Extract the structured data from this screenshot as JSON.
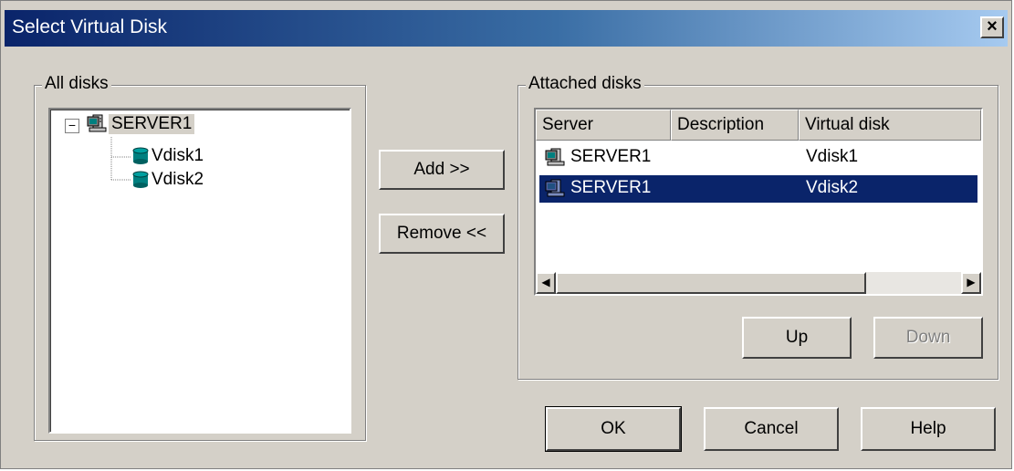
{
  "window": {
    "title": "Select Virtual Disk",
    "close_glyph": "×"
  },
  "all_disks": {
    "label": "All disks",
    "tree": {
      "expander": "−",
      "server": "SERVER1",
      "children": [
        "Vdisk1",
        "Vdisk2"
      ]
    }
  },
  "center_buttons": {
    "add": "Add >>",
    "remove": "Remove <<"
  },
  "attached_disks": {
    "label": "Attached disks",
    "columns": [
      "Server",
      "Description",
      "Virtual disk"
    ],
    "rows": [
      {
        "server": "SERVER1",
        "description": "",
        "virtual_disk": "Vdisk1",
        "selected": false
      },
      {
        "server": "SERVER1",
        "description": "",
        "virtual_disk": "Vdisk2",
        "selected": true
      }
    ],
    "scroll_left": "◀",
    "scroll_right": "▶",
    "up": "Up",
    "down": "Down"
  },
  "footer": {
    "ok": "OK",
    "cancel": "Cancel",
    "help": "Help"
  },
  "icons": [
    "computer-icon",
    "database-icon",
    "close-icon"
  ],
  "colors": {
    "selection": "#0a246a",
    "face": "#d4d0c8",
    "title_start": "#0a246a",
    "title_end": "#a6caf0"
  }
}
